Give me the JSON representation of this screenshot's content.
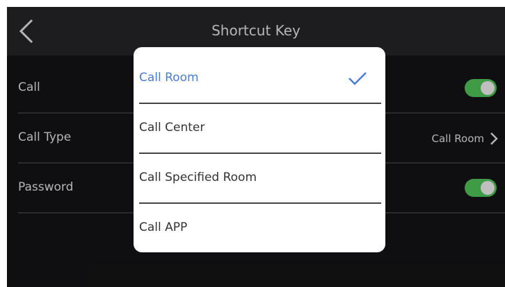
{
  "header": {
    "title": "Shortcut Key"
  },
  "settings": {
    "rows": [
      {
        "label": "Call",
        "toggle": true
      },
      {
        "label": "Call Type",
        "value": "Call Room"
      },
      {
        "label": "Password",
        "toggle": true
      }
    ]
  },
  "dialog": {
    "options": [
      {
        "label": "Call Room",
        "selected": true
      },
      {
        "label": "Call Center"
      },
      {
        "label": "Call Specified Room"
      },
      {
        "label": "Call APP"
      }
    ]
  },
  "colors": {
    "accent": "#4a7bd8",
    "toggle_on": "#56cf5e",
    "background": "#151517",
    "header": "#27272b"
  },
  "icons": {
    "back": "chevron-left-icon",
    "forward": "chevron-right-icon",
    "selected": "check-icon"
  }
}
